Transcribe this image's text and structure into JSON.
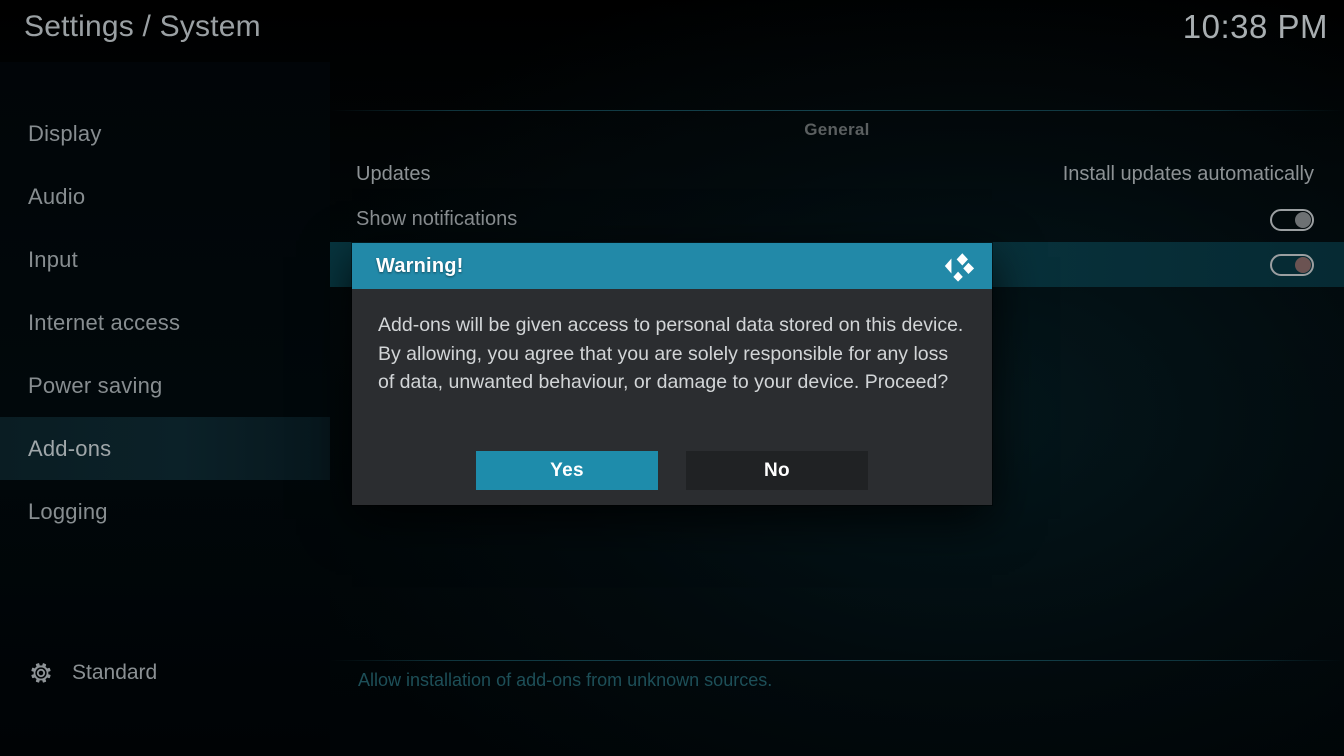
{
  "header": {
    "title": "Settings / System",
    "clock": "10:38 PM"
  },
  "sidebar": {
    "items": [
      {
        "label": "Display",
        "selected": false
      },
      {
        "label": "Audio",
        "selected": false
      },
      {
        "label": "Input",
        "selected": false
      },
      {
        "label": "Internet access",
        "selected": false
      },
      {
        "label": "Power saving",
        "selected": false
      },
      {
        "label": "Add-ons",
        "selected": true
      },
      {
        "label": "Logging",
        "selected": false
      }
    ],
    "footer": {
      "icon": "gear-icon",
      "label": "Standard"
    }
  },
  "content": {
    "group_header": "General",
    "rows": [
      {
        "label": "Updates",
        "value": "Install updates automatically",
        "control": "text"
      },
      {
        "label": "Show notifications",
        "value": "",
        "control": "toggle",
        "toggle_on": true
      },
      {
        "label": "",
        "value": "",
        "control": "toggle",
        "toggle_on": true,
        "highlighted": true
      }
    ],
    "help_text": "Allow installation of add-ons from unknown sources."
  },
  "dialog": {
    "title": "Warning!",
    "logo": "kodi-logo",
    "message": "Add-ons will be given access to personal data stored on this device. By allowing, you agree that you are solely responsible for any loss of data, unwanted behaviour, or damage to your device. Proceed?",
    "buttons": [
      {
        "label": "Yes",
        "style": "primary"
      },
      {
        "label": "No",
        "style": "secondary"
      }
    ]
  },
  "colors": {
    "accent": "#2289a8",
    "button_primary": "#1e8cab",
    "dialog_body": "#2b2d30",
    "highlight_row": "#07353f",
    "help_text": "#1d4f58"
  }
}
